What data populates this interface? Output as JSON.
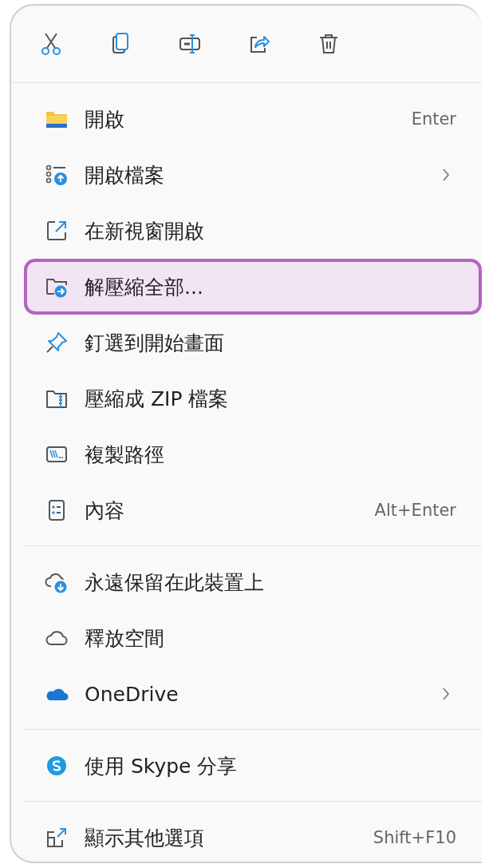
{
  "toolbar": [
    {
      "kind": "cut"
    },
    {
      "kind": "copy"
    },
    {
      "kind": "rename"
    },
    {
      "kind": "share"
    },
    {
      "kind": "delete"
    }
  ],
  "sections": [
    {
      "items": [
        {
          "kind": "folder",
          "label": "開啟",
          "shortcut": "Enter",
          "submenu": false,
          "selected": false
        },
        {
          "kind": "open-with",
          "label": "開啟檔案",
          "submenu": true,
          "selected": false
        },
        {
          "kind": "new-window",
          "label": "在新視窗開啟",
          "submenu": false,
          "selected": false
        },
        {
          "kind": "extract",
          "label": "解壓縮全部...",
          "submenu": false,
          "selected": true
        },
        {
          "kind": "pin",
          "label": "釘選到開始畫面",
          "submenu": false,
          "selected": false
        },
        {
          "kind": "zip",
          "label": "壓縮成 ZIP 檔案",
          "submenu": false,
          "selected": false
        },
        {
          "kind": "path",
          "label": "複製路徑",
          "submenu": false,
          "selected": false
        },
        {
          "kind": "properties",
          "label": "內容",
          "shortcut": "Alt+Enter",
          "submenu": false,
          "selected": false
        }
      ]
    },
    {
      "items": [
        {
          "kind": "cloud-download",
          "label": "永遠保留在此裝置上",
          "submenu": false,
          "selected": false
        },
        {
          "kind": "cloud",
          "label": "釋放空間",
          "submenu": false,
          "selected": false
        },
        {
          "kind": "cloud-filled",
          "label": "OneDrive",
          "submenu": true,
          "selected": false
        }
      ]
    },
    {
      "items": [
        {
          "kind": "skype",
          "label": "使用 Skype 分享",
          "submenu": false,
          "selected": false
        }
      ]
    },
    {
      "items": [
        {
          "kind": "more",
          "label": "顯示其他選項",
          "shortcut": "Shift+F10",
          "submenu": false,
          "selected": false
        }
      ]
    }
  ]
}
